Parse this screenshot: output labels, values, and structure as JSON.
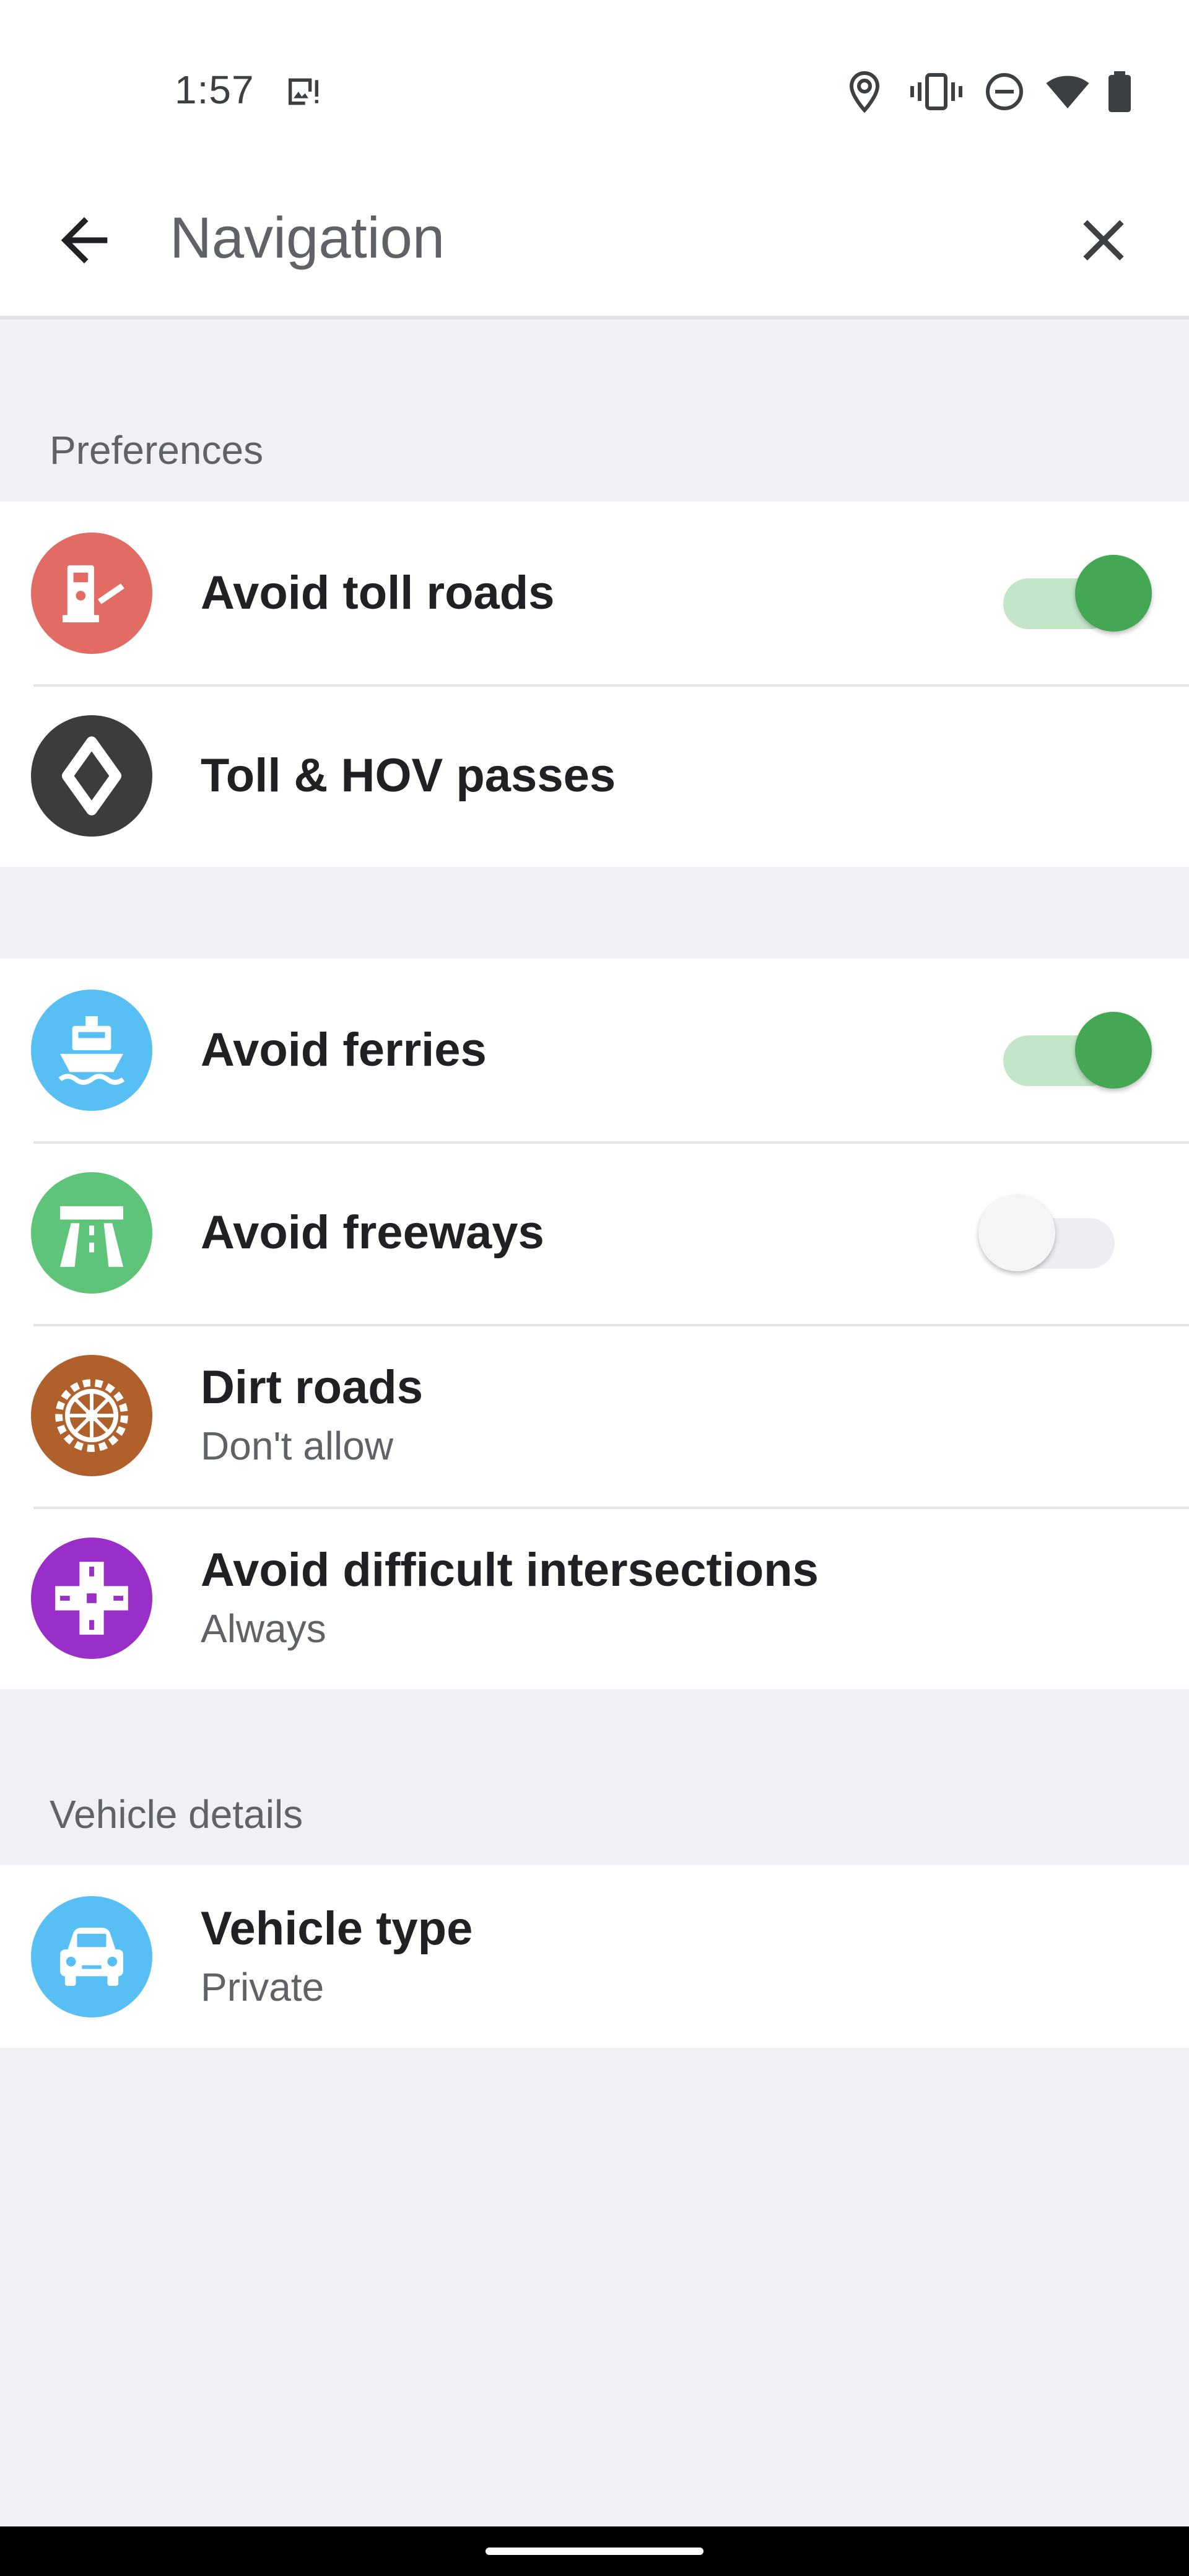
{
  "status_bar": {
    "time": "1:57",
    "icons": [
      "gallery-icon",
      "location-icon",
      "vibrate-icon",
      "do-not-disturb-icon",
      "wifi-icon",
      "battery-icon"
    ]
  },
  "app_bar": {
    "title": "Navigation",
    "back_icon": "arrow-back-icon",
    "close_icon": "close-icon"
  },
  "sections": {
    "preferences": {
      "header": "Preferences"
    },
    "vehicle": {
      "header": "Vehicle details"
    }
  },
  "preferences_card_1": [
    {
      "title": "Avoid toll roads",
      "icon": "toll-booth-icon",
      "icon_color": "#e26b64",
      "toggle": true
    },
    {
      "title": "Toll & HOV passes",
      "icon": "diamond-icon",
      "icon_color": "#3c3c3c"
    }
  ],
  "preferences_card_2": [
    {
      "title": "Avoid ferries",
      "icon": "ferry-icon",
      "icon_color": "#58bff5",
      "toggle": true
    },
    {
      "title": "Avoid freeways",
      "icon": "freeway-icon",
      "icon_color": "#5ec47a",
      "toggle": false
    },
    {
      "title": "Dirt roads",
      "subtitle": "Don't allow",
      "icon": "wheel-icon",
      "icon_color": "#b0602a"
    },
    {
      "title": "Avoid difficult intersections",
      "subtitle": "Always",
      "icon": "intersection-icon",
      "icon_color": "#9a2ec8"
    }
  ],
  "vehicle_card": [
    {
      "title": "Vehicle type",
      "subtitle": "Private",
      "icon": "car-icon",
      "icon_color": "#58bff5"
    }
  ],
  "colors": {
    "toggle_on_thumb": "#43a754",
    "toggle_on_track": "#c3e6c9",
    "background": "#f0f1f5"
  }
}
